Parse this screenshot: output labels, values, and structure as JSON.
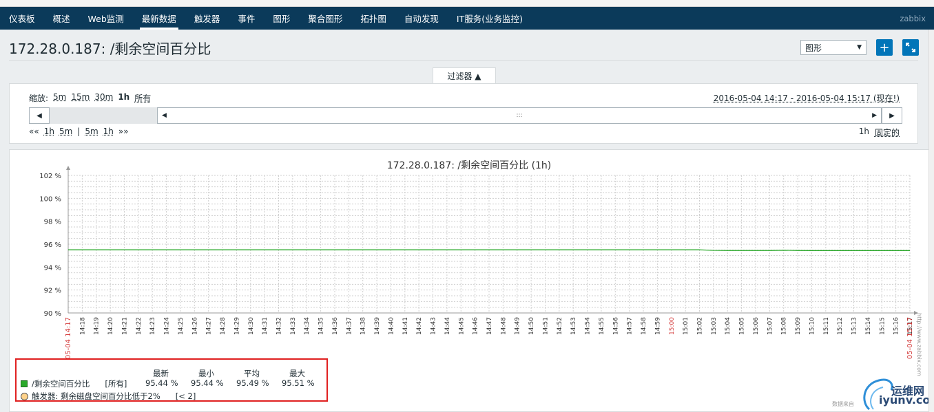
{
  "nav": {
    "items": [
      "仪表板",
      "概述",
      "Web监测",
      "最新数据",
      "触发器",
      "事件",
      "图形",
      "聚合图形",
      "拓扑图",
      "自动发现",
      "IT服务(业务监控)"
    ],
    "active_index": 3,
    "brand": "zabbix"
  },
  "header": {
    "title": "172.28.0.187: /剩余空间百分比",
    "view_select": "图形",
    "add_icon": "plus-icon",
    "fullscreen_icon": "fullscreen-icon"
  },
  "filter": {
    "tab_label": "过滤器 ▲",
    "zoom_label": "缩放:",
    "zoom_options": [
      "5m",
      "15m",
      "30m",
      "1h",
      "所有"
    ],
    "zoom_current": "1h",
    "time_range": "2016-05-04 14:17 - 2016-05-04 15:17 (现在!)",
    "scroll_grip": ":::",
    "nav_links": [
      "««",
      "1h",
      "5m",
      "|",
      "5m",
      "1h",
      "»»"
    ],
    "period_label": "1h",
    "fixed_label": "固定的"
  },
  "graph": {
    "title": "172.28.0.187: /剩余空间百分比 (1h)",
    "legend": {
      "headers": [
        "最新",
        "最小",
        "平均",
        "最大"
      ],
      "item_name": "/剩余空间百分比",
      "item_func": "[所有]",
      "values": [
        "95.44 %",
        "95.44 %",
        "95.49 %",
        "95.51 %"
      ],
      "trigger": "触发器: 剩余磁盘空间百分比低于2%",
      "trigger_cond": "[< 2]"
    },
    "watermark_top": "运维网",
    "watermark_bottom": "iyunv.com",
    "watermark_small": "数据来自",
    "side_text": "http://www.zabbix.com"
  },
  "chart_data": {
    "type": "line",
    "title": "172.28.0.187: /剩余空间百分比 (1h)",
    "ylim": [
      90,
      102
    ],
    "y_ticks": [
      "90 %",
      "92 %",
      "94 %",
      "96 %",
      "98 %",
      "100 %",
      "102 %"
    ],
    "x_tick_labels": [
      "05-04 14:17",
      "14:18",
      "14:19",
      "14:20",
      "14:21",
      "14:22",
      "14:23",
      "14:24",
      "14:25",
      "14:26",
      "14:27",
      "14:28",
      "14:29",
      "14:30",
      "14:31",
      "14:32",
      "14:33",
      "14:34",
      "14:35",
      "14:36",
      "14:37",
      "14:38",
      "14:39",
      "14:40",
      "14:41",
      "14:42",
      "14:43",
      "14:44",
      "14:45",
      "14:46",
      "14:47",
      "14:48",
      "14:49",
      "14:50",
      "14:51",
      "14:52",
      "14:53",
      "14:54",
      "14:55",
      "14:56",
      "14:57",
      "14:58",
      "14:59",
      "15:00",
      "15:01",
      "15:02",
      "15:03",
      "15:04",
      "15:05",
      "15:06",
      "15:07",
      "15:08",
      "15:09",
      "15:10",
      "15:11",
      "15:12",
      "15:13",
      "15:14",
      "15:15",
      "15:16",
      "15:17",
      "05-04 15:17"
    ],
    "x_red_labels": [
      "05-04 14:17",
      "15:00",
      "05-04 15:17"
    ],
    "series": [
      {
        "name": "/剩余空间百分比",
        "color": "#2aa92a",
        "x": [
          "14:17",
          "14:18",
          "14:19",
          "14:20",
          "14:21",
          "14:22",
          "14:23",
          "14:24",
          "14:25",
          "14:26",
          "14:27",
          "14:28",
          "14:29",
          "14:30",
          "14:31",
          "14:32",
          "14:33",
          "14:34",
          "14:35",
          "14:36",
          "14:37",
          "14:38",
          "14:39",
          "14:40",
          "14:41",
          "14:42",
          "14:43",
          "14:44",
          "14:45",
          "14:46",
          "14:47",
          "14:48",
          "14:49",
          "14:50",
          "14:51",
          "14:52",
          "14:53",
          "14:54",
          "14:55",
          "14:56",
          "14:57",
          "14:58",
          "14:59",
          "15:00",
          "15:01",
          "15:02",
          "15:03",
          "15:04",
          "15:05",
          "15:06",
          "15:07",
          "15:08",
          "15:09",
          "15:10",
          "15:11",
          "15:12",
          "15:13",
          "15:14",
          "15:15",
          "15:16",
          "15:17"
        ],
        "values": [
          95.51,
          95.51,
          95.51,
          95.51,
          95.51,
          95.51,
          95.51,
          95.51,
          95.51,
          95.51,
          95.51,
          95.51,
          95.51,
          95.51,
          95.51,
          95.51,
          95.51,
          95.51,
          95.51,
          95.51,
          95.51,
          95.51,
          95.51,
          95.51,
          95.51,
          95.51,
          95.51,
          95.51,
          95.51,
          95.51,
          95.51,
          95.51,
          95.51,
          95.51,
          95.51,
          95.51,
          95.51,
          95.51,
          95.51,
          95.51,
          95.51,
          95.51,
          95.51,
          95.51,
          95.51,
          95.51,
          95.46,
          95.45,
          95.45,
          95.45,
          95.45,
          95.47,
          95.45,
          95.44,
          95.44,
          95.44,
          95.44,
          95.44,
          95.44,
          95.44,
          95.44
        ]
      }
    ],
    "grid": true,
    "legend_position": "bottom-left"
  }
}
